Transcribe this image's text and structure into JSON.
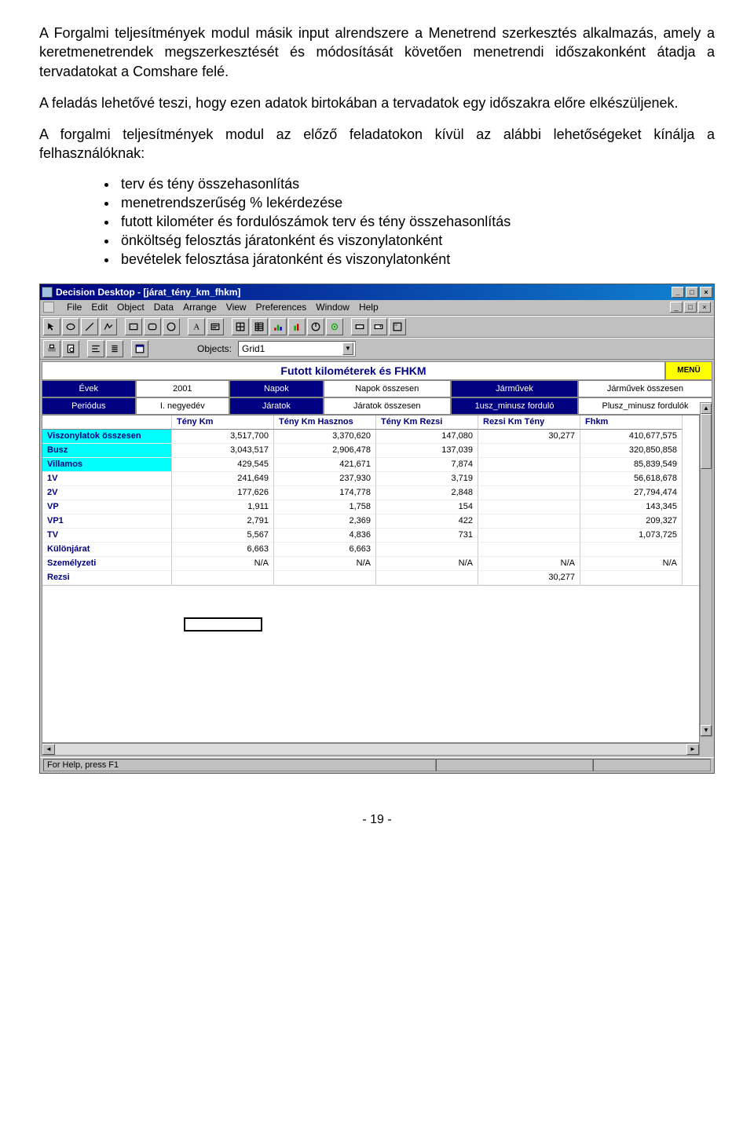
{
  "paragraphs": {
    "p1": "A Forgalmi teljesítmények modul másik input alrendszere a Menetrend szerkesztés alkalmazás, amely a keretmenetrendek megszerkesztését és módosítását követően menetrendi időszakonként átadja a tervadatokat a Comshare felé.",
    "p2": "A feladás lehetővé teszi, hogy ezen adatok birtokában a tervadatok egy időszakra előre elkészüljenek.",
    "p3": "A forgalmi teljesítmények modul az előző feladatokon kívül az alábbi lehetőségeket kínálja a felhasználóknak:"
  },
  "bullets": [
    "terv és tény összehasonlítás",
    "menetrendszerűség % lekérdezése",
    "futott kilométer és fordulószámok terv és tény összehasonlítás",
    "önköltség felosztás járatonként és viszonylatonként",
    "bevételek felosztása járatonként és viszonylatonként"
  ],
  "app": {
    "title": "Decision Desktop - [járat_tény_km_fhkm]",
    "menus": [
      "File",
      "Edit",
      "Object",
      "Data",
      "Arrange",
      "View",
      "Preferences",
      "Window",
      "Help"
    ],
    "objects_label": "Objects:",
    "objects_value": "Grid1",
    "chart_title": "Futott kilométerek és FHKM",
    "menu_button": "MENÜ",
    "filters": {
      "row1": [
        {
          "k": "Évek",
          "v": "2001"
        },
        {
          "k": "Napok",
          "v": "Napok összesen"
        },
        {
          "k": "Járművek",
          "v": "Járművek összesen"
        }
      ],
      "row2": [
        {
          "k": "Periódus",
          "v": "I. negyedév"
        },
        {
          "k": "Járatok",
          "v": "Járatok összesen"
        },
        {
          "k": "1usz_minusz forduló",
          "v": "Plusz_minusz fordulók"
        }
      ]
    },
    "columns": [
      "",
      "Tény Km",
      "Tény Km Hasznos",
      "Tény Km Rezsi",
      "Rezsi Km Tény",
      "Fhkm"
    ],
    "rows": [
      {
        "name": "Viszonylatok összesen",
        "cyan": true,
        "cells": [
          "3,517,700",
          "3,370,620",
          "147,080",
          "30,277",
          "410,677,575"
        ]
      },
      {
        "name": "Busz",
        "cyan": true,
        "cells": [
          "3,043,517",
          "2,906,478",
          "137,039",
          "",
          "320,850,858"
        ]
      },
      {
        "name": "Villamos",
        "cyan": true,
        "cells": [
          "429,545",
          "421,671",
          "7,874",
          "",
          "85,839,549"
        ]
      },
      {
        "name": "1V",
        "cyan": false,
        "cells": [
          "241,649",
          "237,930",
          "3,719",
          "",
          "56,618,678"
        ]
      },
      {
        "name": "2V",
        "cyan": false,
        "cells": [
          "177,626",
          "174,778",
          "2,848",
          "",
          "27,794,474"
        ]
      },
      {
        "name": "VP",
        "cyan": false,
        "cells": [
          "1,911",
          "1,758",
          "154",
          "",
          "143,345"
        ]
      },
      {
        "name": "VP1",
        "cyan": false,
        "cells": [
          "2,791",
          "2,369",
          "422",
          "",
          "209,327"
        ]
      },
      {
        "name": "TV",
        "cyan": false,
        "cells": [
          "5,567",
          "4,836",
          "731",
          "",
          "1,073,725"
        ]
      },
      {
        "name": "Különjárat",
        "cyan": false,
        "cells": [
          "6,663",
          "6,663",
          "",
          "",
          ""
        ]
      },
      {
        "name": "Személyzeti",
        "cyan": false,
        "cells": [
          "N/A",
          "N/A",
          "N/A",
          "N/A",
          "N/A"
        ]
      },
      {
        "name": "Rezsi",
        "cyan": false,
        "cells": [
          "",
          "",
          "",
          "30,277",
          ""
        ]
      }
    ],
    "status": "For Help, press F1"
  },
  "page_number": "- 19 -"
}
